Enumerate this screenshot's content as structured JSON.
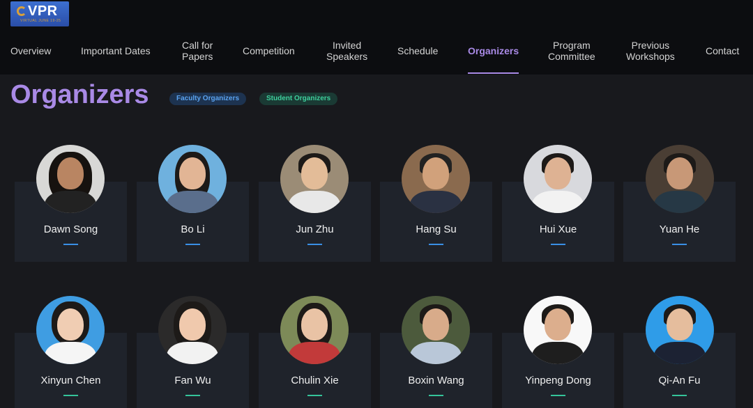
{
  "logo": {
    "text": "VPR",
    "sub": "VIRTUAL JUNE 19-25"
  },
  "nav": {
    "overview": "Overview",
    "important_dates": "Important Dates",
    "call_for_papers": [
      "Call for",
      "Papers"
    ],
    "competition": "Competition",
    "invited_speakers": [
      "Invited",
      "Speakers"
    ],
    "schedule": "Schedule",
    "organizers": "Organizers",
    "program_committee": [
      "Program",
      "Committee"
    ],
    "previous_workshops": [
      "Previous",
      "Workshops"
    ],
    "contact": "Contact",
    "active_color": "#a98ae6"
  },
  "page": {
    "title": "Organizers",
    "faculty_pill": "Faculty Organizers",
    "student_pill": "Student Organizers"
  },
  "faculty": [
    {
      "name": "Dawn Song"
    },
    {
      "name": "Bo Li"
    },
    {
      "name": "Jun Zhu"
    },
    {
      "name": "Hang Su"
    },
    {
      "name": "Hui Xue"
    },
    {
      "name": "Yuan He"
    }
  ],
  "students": [
    {
      "name": "Xinyun Chen"
    },
    {
      "name": "Fan Wu"
    },
    {
      "name": "Chulin Xie"
    },
    {
      "name": "Boxin Wang"
    },
    {
      "name": "Yinpeng Dong"
    },
    {
      "name": "Qi-An Fu"
    }
  ],
  "colors": {
    "accent": "#a98ae6",
    "faculty": "#3a8fe6",
    "student": "#35c49a",
    "card_bg": "#1f232b",
    "page_bg": "#18191d"
  }
}
